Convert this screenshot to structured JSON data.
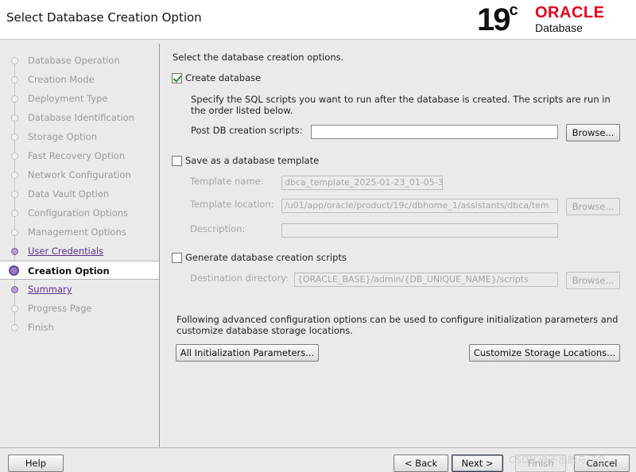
{
  "window": {
    "title": "Select Database Creation Option"
  },
  "logo": {
    "version": "19",
    "version_sup": "c",
    "brand": "ORACLE",
    "product": "Database"
  },
  "steps": [
    {
      "label": "Database Operation",
      "state": "pending"
    },
    {
      "label": "Creation Mode",
      "state": "pending"
    },
    {
      "label": "Deployment Type",
      "state": "pending"
    },
    {
      "label": "Database Identification",
      "state": "pending"
    },
    {
      "label": "Storage Option",
      "state": "pending"
    },
    {
      "label": "Fast Recovery Option",
      "state": "pending"
    },
    {
      "label": "Network Configuration",
      "state": "pending"
    },
    {
      "label": "Data Vault Option",
      "state": "pending"
    },
    {
      "label": "Configuration Options",
      "state": "pending"
    },
    {
      "label": "Management Options",
      "state": "pending"
    },
    {
      "label": "User Credentials",
      "state": "done"
    },
    {
      "label": "Creation Option",
      "state": "active"
    },
    {
      "label": "Summary",
      "state": "link"
    },
    {
      "label": "Progress Page",
      "state": "pending"
    },
    {
      "label": "Finish",
      "state": "pending"
    }
  ],
  "content": {
    "intro": "Select the database creation options.",
    "create_db": {
      "label": "Create database",
      "checked": true,
      "desc_line1": "Specify the SQL scripts you want to run after the database is created. The scripts are run in",
      "desc_line2": "the order listed below.",
      "post_scripts_label": "Post DB creation scripts:",
      "post_scripts_value": "",
      "browse_label": "Browse..."
    },
    "save_template": {
      "label": "Save as a database template",
      "checked": false,
      "name_label": "Template name:",
      "name_value": "dbca_template_2025-01-23_01-05-3",
      "location_label": "Template location:",
      "location_value": "/u01/app/oracle/product/19c/dbhome_1/assistants/dbca/tem",
      "browse_label": "Browse...",
      "description_label": "Description:",
      "description_value": ""
    },
    "gen_scripts": {
      "label": "Generate database creation scripts",
      "checked": false,
      "dest_label": "Destination directory:",
      "dest_value": "{ORACLE_BASE}/admin/{DB_UNIQUE_NAME}/scripts",
      "browse_label": "Browse..."
    },
    "advanced_line1": "Following advanced configuration options can be used to configure initialization parameters and",
    "advanced_line2": "customize database storage locations.",
    "init_params_label": "All Initialization Parameters...",
    "storage_locations_label": "Customize Storage Locations..."
  },
  "footer": {
    "help_label": "Help",
    "back_label": "< Back",
    "next_label": "Next >",
    "finish_label": "Finish",
    "cancel_label": "Cancel"
  },
  "watermark": "CSDN @不出的舟仔全"
}
